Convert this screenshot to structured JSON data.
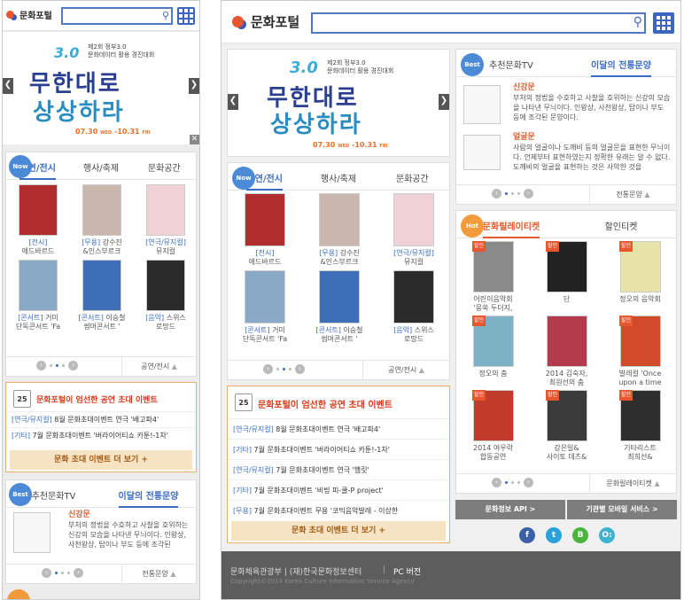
{
  "header": {
    "logo_text": "문화포털",
    "search_placeholder": ""
  },
  "banner": {
    "edition": "3.0",
    "sub1": "제2회 정부3.0",
    "sub2": "문화데이터 활용 경진대회",
    "line1": "무한대로",
    "line2": "상상하라",
    "date_start": "07.30",
    "date_start_day": "WED",
    "date_end": "10.31",
    "date_end_day": "FRI"
  },
  "badges": {
    "now": "Now",
    "best": "Best",
    "hot": "Hot"
  },
  "performance": {
    "tabs": [
      "공연/전시",
      "행사/축제",
      "문화공간"
    ],
    "items": [
      {
        "cat": "[전시]",
        "title": "에드바르드",
        "color": "#b22e2e"
      },
      {
        "cat": "[무용]",
        "title": "강수진 &인스부르크",
        "title_left": "강수진",
        "title_left2": "&인스부르크",
        "color": "#c9b7ae"
      },
      {
        "cat": "[연극/뮤지컬]",
        "title": "뮤지컬",
        "color": "#f0d2d6"
      },
      {
        "cat": "[콘서트]",
        "title": "거미 단독콘서트 'Fa",
        "title_left": "거미",
        "title_left2": "단독콘서트 'Fa",
        "color": "#8aa9c7"
      },
      {
        "cat": "[콘서트]",
        "title": "이승철 썸머콘서트 '",
        "title_left": "이승철",
        "title_left2": "썸머콘서트 '",
        "color": "#3d6fb8"
      },
      {
        "cat": "[음악]",
        "title": "스위스 로망드",
        "title_left": "스위스",
        "title_left2": "로망드",
        "color": "#2b2b2b"
      }
    ],
    "more": "공연/전시"
  },
  "event": {
    "cal": "25",
    "title": "문화포털이 엄선한 공연 초대 이벤트",
    "rows": [
      {
        "cat": "[연극/뮤지컬]",
        "text": " 8월 문화초대이벤트 연극 '배고파4'"
      },
      {
        "cat": "[기타]",
        "text": " 7월 문화초대이벤트 '버라이어티쇼 카툰!-1차'"
      },
      {
        "cat": "[연극/뮤지컬]",
        "text": " 7월 문화초대이벤트 연극 '햄릿'"
      },
      {
        "cat": "[기타]",
        "text": " 7월 문화초대이벤트 '비빙 피-쿨-P project'"
      },
      {
        "cat": "[무용]",
        "text": " 7월 문화초대이벤트 무용 '코믹음악발레 - 이상한"
      }
    ],
    "more": "문화 초대 이벤트 더 보기  +"
  },
  "tradition": {
    "tabs": [
      "추천문화TV",
      "이달의 전통문양"
    ],
    "items": [
      {
        "name": "신강문",
        "desc": "부처의 정법을 수호하고 사찰을 호위하는 신강의 모습을 나타낸 무늬이다. 인왕상, 사천왕상, 탑이나 부도 등에 조각된 문양이다."
      },
      {
        "name": "얼굴문",
        "desc": "사람의 얼굴이나 도깨비 등의 얼굴문을 표현한 무늬이다. 언제부터 표현하였는지 정확한 유래는 알 수 없다. 도깨비의 얼굴을 표현하는 것은 사악한 것을"
      }
    ],
    "p1_desc": "부처의 정법을 수호하고 사찰을 호위하는 신강의 모습을 나타낸 무늬이다. 인왕상, 사천왕상, 탑이나 부도 등에 조각된",
    "more": "전통문양"
  },
  "tickets": {
    "tabs": [
      "문화릴레이티켓",
      "할인티켓"
    ],
    "discount_label": "할인",
    "items": [
      {
        "title": "어린이음악회 '뭉쑥 두더지,",
        "l1": "어린이음악회",
        "l2": "'뭉쑥 두더지,",
        "color": "#8a8a8a"
      },
      {
        "title": "단",
        "l1": "단",
        "l2": "",
        "color": "#222"
      },
      {
        "title": "정오의 음악회",
        "l1": "정오의 음악회",
        "l2": "",
        "color": "#e7e2a8"
      },
      {
        "title": "정오의 춤",
        "l1": "정오의 춤",
        "l2": "",
        "color": "#7bb3c4"
      },
      {
        "title": "2014 김숙자, 최원선의 춤",
        "l1": "2014 김숙자,",
        "l2": "최원선의 춤",
        "color": "#b33a4a"
      },
      {
        "title": "발레컬 'Once upon a time",
        "l1": "발레컬 'Once",
        "l2": "upon a time",
        "color": "#d14b2a"
      },
      {
        "title": "2014 여우락 합동공연",
        "l1": "2014 여우락",
        "l2": "합동공연",
        "color": "#c23a2a"
      },
      {
        "title": "강은일& 사이토 데츠&",
        "l1": "강은일&",
        "l2": "사이토 데츠&",
        "color": "#3b3b3b"
      },
      {
        "title": "기타리스트 최희선&",
        "l1": "기타리스트",
        "l2": "최희선&",
        "color": "#2e2e2e"
      }
    ],
    "more": "문화릴레이티켓"
  },
  "buttons": {
    "api": "문화정보 API  >",
    "mobile": "기관별 모바일 서비스  >"
  },
  "social": {
    "facebook": "f",
    "twitter": "t",
    "band": "B",
    "kakao": "O:",
    "facebook_color": "#3b5fa8",
    "twitter_color": "#2aa0dc",
    "band_color": "#4ab43c",
    "kakao_color": "#3fb2cf"
  },
  "footer": {
    "org": "문화체육관광부 | (재)한국문화정보센터",
    "pc": "PC 버전",
    "copyright": "Copyright©2014 Korea Culture Information Service Agency"
  }
}
